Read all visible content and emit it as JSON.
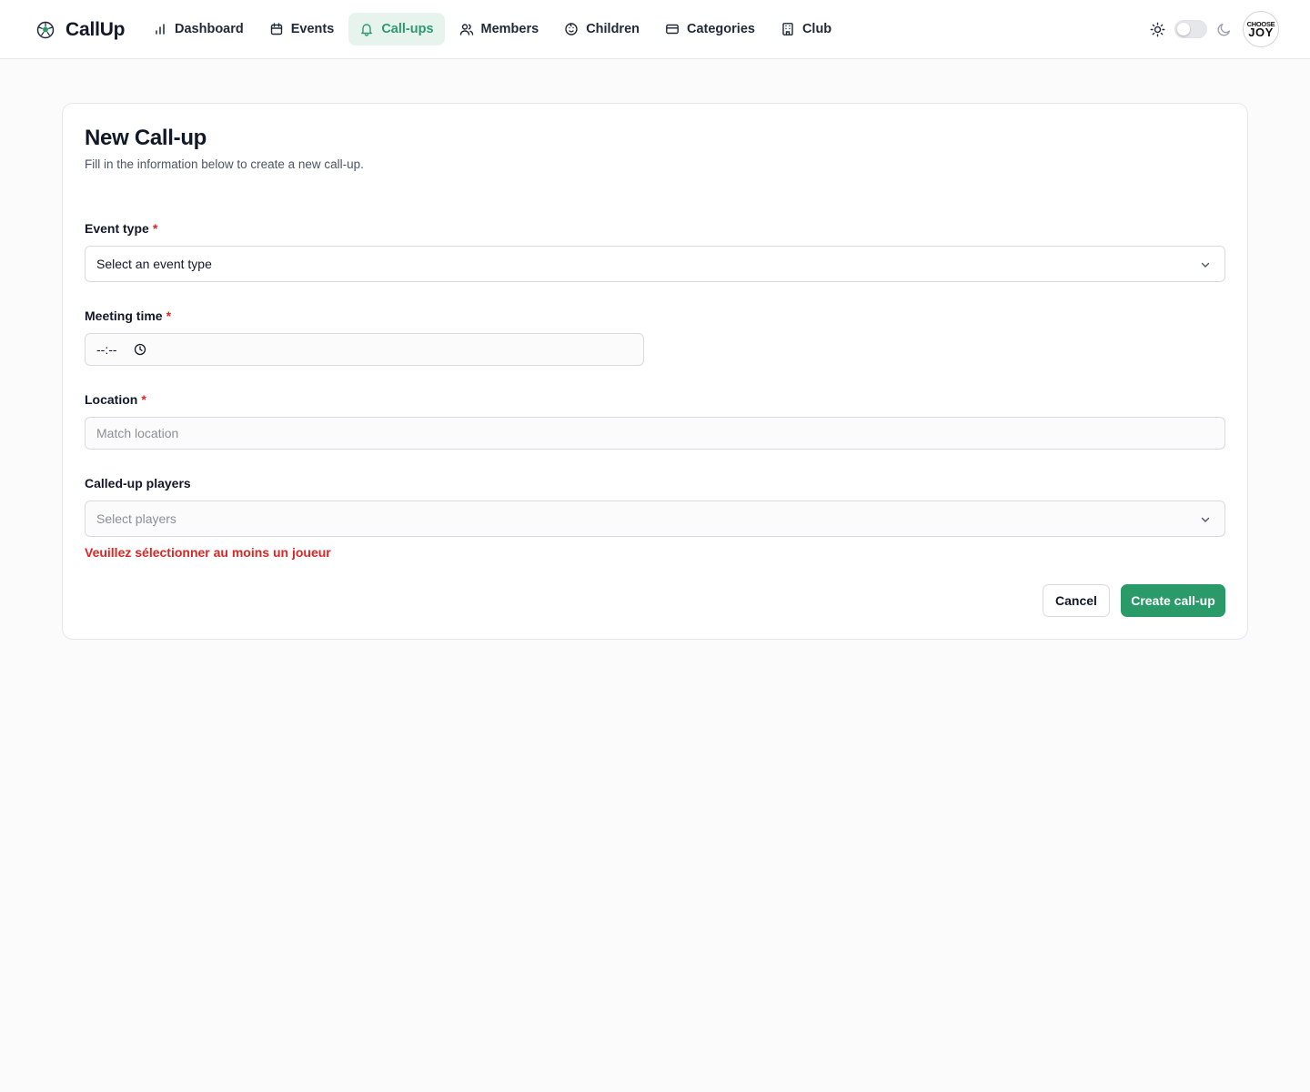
{
  "app": {
    "name": "CallUp",
    "logo_icon": "soccer-ball-icon"
  },
  "nav": {
    "items": [
      {
        "label": "Dashboard",
        "icon": "bar-chart-icon",
        "active": false
      },
      {
        "label": "Events",
        "icon": "calendar-icon",
        "active": false
      },
      {
        "label": "Call-ups",
        "icon": "bell-icon",
        "active": true
      },
      {
        "label": "Members",
        "icon": "users-icon",
        "active": false
      },
      {
        "label": "Children",
        "icon": "baby-face-icon",
        "active": false
      },
      {
        "label": "Categories",
        "icon": "card-icon",
        "active": false
      },
      {
        "label": "Club",
        "icon": "building-icon",
        "active": false
      }
    ]
  },
  "header_tools": {
    "theme_toggle_on": false,
    "avatar": {
      "line1": "CHOOSE",
      "line2": "JOY"
    }
  },
  "form": {
    "title": "New Call-up",
    "subtitle": "Fill in the information below to create a new call-up.",
    "event_type": {
      "label": "Event type",
      "required_mark": "*",
      "value": "Select an event type"
    },
    "meeting_time": {
      "label": "Meeting time",
      "required_mark": "*",
      "value": "--:--"
    },
    "location": {
      "label": "Location",
      "required_mark": "*",
      "placeholder": "Match location"
    },
    "players": {
      "label": "Called-up players",
      "placeholder": "Select players"
    },
    "error": "Veuillez sélectionner au moins un joueur",
    "cancel_label": "Cancel",
    "submit_label": "Create call-up"
  },
  "colors": {
    "accent": "#2a9a69",
    "active_nav_bg": "#e7f4ee",
    "error": "#dc2626"
  }
}
